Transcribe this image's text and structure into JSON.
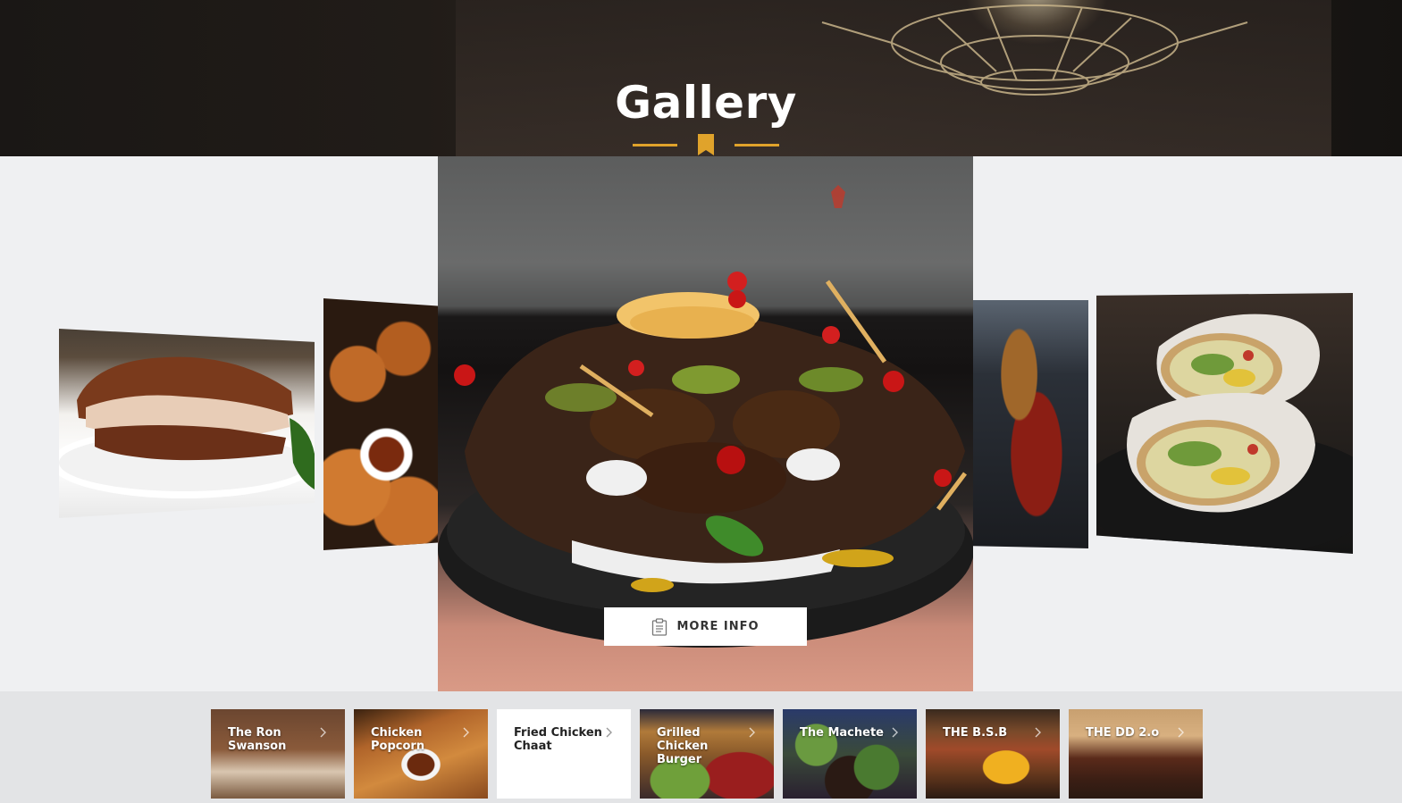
{
  "header": {
    "title": "Gallery"
  },
  "carousel": {
    "more_info_label": "MORE INFO",
    "slides": [
      {
        "name": "The Ron Swanson"
      },
      {
        "name": "Chicken Popcorn"
      },
      {
        "name": "Fried Chicken Chaat",
        "active": true
      },
      {
        "name": "Grilled Chicken Burger"
      },
      {
        "name": "The Machete"
      }
    ]
  },
  "thumbnails": [
    {
      "label": "The Ron Swanson",
      "active": false
    },
    {
      "label": "Chicken Popcorn",
      "active": false
    },
    {
      "label": "Fried Chicken Chaat",
      "active": true
    },
    {
      "label": "Grilled Chicken Burger",
      "active": false
    },
    {
      "label": "The Machete",
      "active": false
    },
    {
      "label": "THE B.S.B",
      "active": false
    },
    {
      "label": "THE DD 2.o",
      "active": false
    }
  ],
  "colors": {
    "accent": "#e0a32b",
    "header_bg": "#1e1a17",
    "stage_bg": "#eff0f2",
    "thumb_bar_bg": "#e3e4e6"
  },
  "icons": {
    "divider": "bookmark-icon",
    "more_info": "clipboard-icon",
    "thumb": "chevron-right-icon"
  }
}
